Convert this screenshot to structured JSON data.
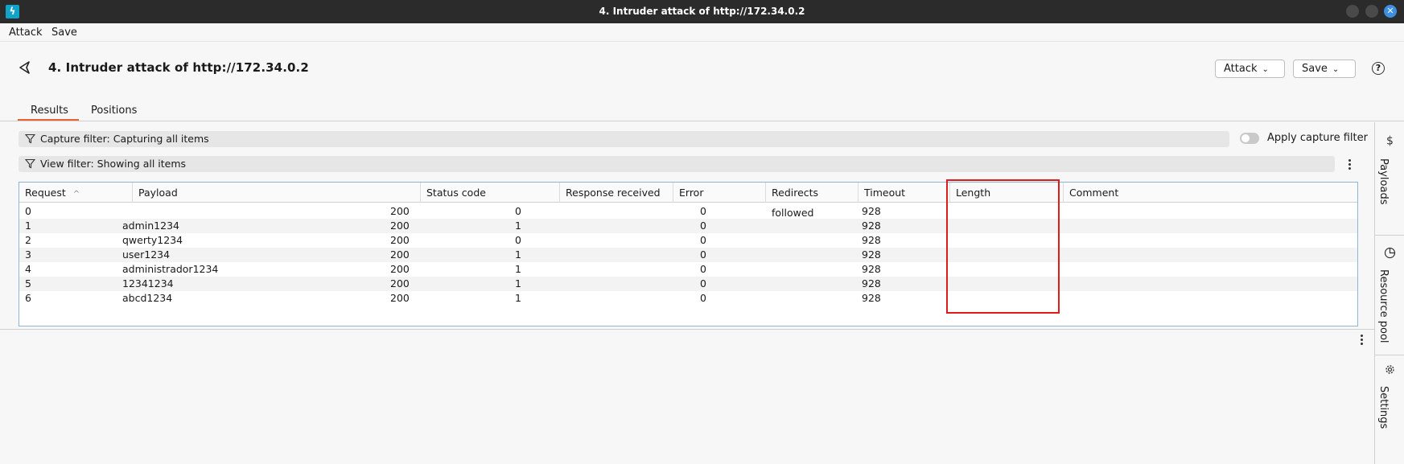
{
  "window": {
    "title": "4. Intruder attack of http://172.34.0.2",
    "app_icon_glyph": "ϟ",
    "close_glyph": "✕"
  },
  "menubar": {
    "items": [
      "Attack",
      "Save"
    ]
  },
  "header": {
    "title": "4. Intruder attack of http://172.34.0.2",
    "attack_button": "Attack",
    "save_button": "Save",
    "help_glyph": "?"
  },
  "tabs": [
    {
      "label": "Results",
      "active": true
    },
    {
      "label": "Positions",
      "active": false
    }
  ],
  "capture_filter": {
    "label": "Capture filter: Capturing all items",
    "apply_label": "Apply capture filter",
    "apply_enabled": false
  },
  "view_filter": {
    "label": "View filter: Showing all items"
  },
  "table": {
    "columns": [
      "Request",
      "Payload",
      "Status code",
      "Response received",
      "Error",
      "Redirects followed",
      "Timeout",
      "Length",
      "Comment"
    ],
    "sort_glyph": "^",
    "rows": [
      [
        "0",
        "",
        "200",
        "0",
        "",
        "0",
        "",
        "928",
        ""
      ],
      [
        "1",
        "admin1234",
        "200",
        "1",
        "",
        "0",
        "",
        "928",
        ""
      ],
      [
        "2",
        "qwerty1234",
        "200",
        "0",
        "",
        "0",
        "",
        "928",
        ""
      ],
      [
        "3",
        "user1234",
        "200",
        "1",
        "",
        "0",
        "",
        "928",
        ""
      ],
      [
        "4",
        "administrador1234",
        "200",
        "1",
        "",
        "0",
        "",
        "928",
        ""
      ],
      [
        "5",
        "12341234",
        "200",
        "1",
        "",
        "0",
        "",
        "928",
        ""
      ],
      [
        "6",
        "abcd1234",
        "200",
        "1",
        "",
        "0",
        "",
        "928",
        ""
      ]
    ]
  },
  "side_panel": {
    "items": [
      "Payloads",
      "Resource pool",
      "Settings"
    ]
  },
  "colors": {
    "accent": "#e8642c",
    "highlight": "#e01b1b",
    "app_icon": "#12a3c9",
    "close_button": "#3d8fe0"
  }
}
